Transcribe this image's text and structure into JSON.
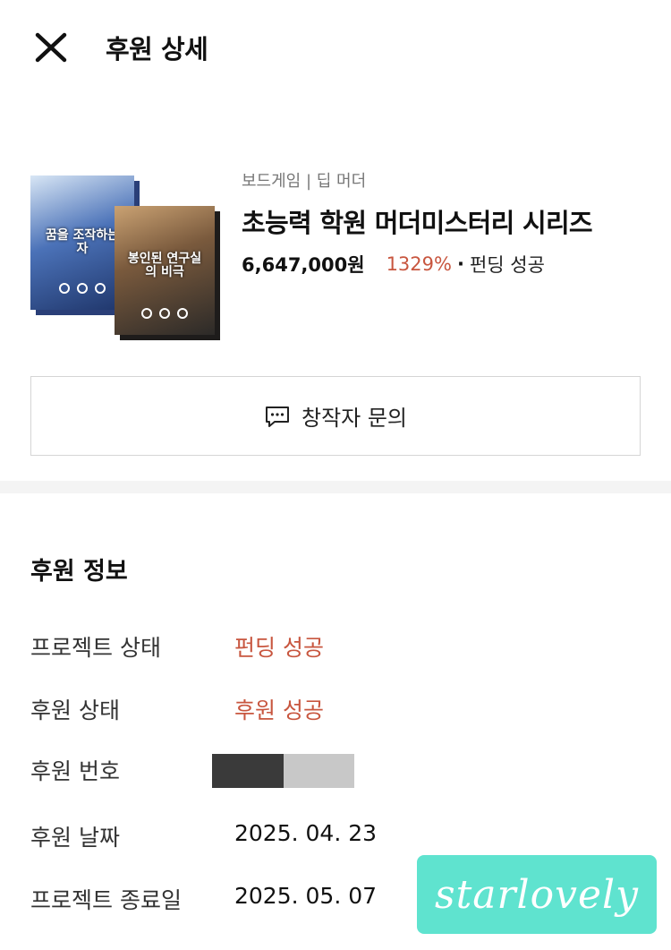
{
  "header": {
    "title": "후원 상세",
    "close_icon": "close-icon"
  },
  "project": {
    "category": "보드게임 | 딥 머더",
    "title": "초능력 학원 머더미스터리 시리즈",
    "amount": "6,647,000원",
    "percent": "1329%",
    "separator": "·",
    "status": "펀딩 성공",
    "cover_box1_text": "꿈을 조작하는 자",
    "cover_box2_text": "봉인된 연구실의 비극",
    "accent_color": "#c8563f"
  },
  "inquiry": {
    "label": "창작자 문의",
    "icon": "chat-bubble-icon"
  },
  "support_info": {
    "title": "후원 정보",
    "rows": [
      {
        "label": "프로젝트 상태",
        "value": "펀딩 성공"
      },
      {
        "label": "후원 상태",
        "value": "후원 성공"
      },
      {
        "label": "후원 번호",
        "value": ""
      },
      {
        "label": "후원 날짜",
        "value": "2025. 04. 23"
      },
      {
        "label": "프로젝트 종료일",
        "value": "2025. 05. 07"
      }
    ]
  },
  "watermark": {
    "text": "starlovely"
  }
}
